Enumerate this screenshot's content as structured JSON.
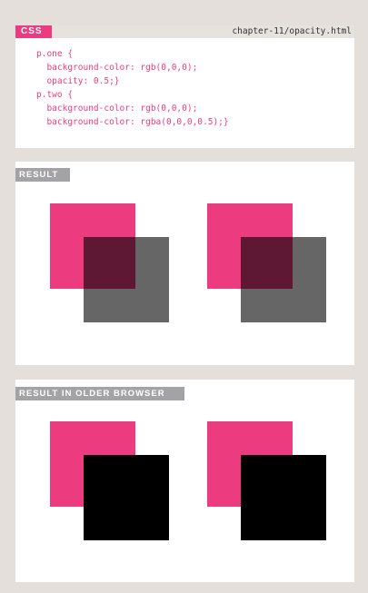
{
  "code_section": {
    "badge": "CSS",
    "file_path": "chapter-11/opacity.html",
    "code_lines": [
      "p.one {",
      "  background-color: rgb(0,0,0);",
      "  opacity: 0.5;}",
      "p.two {",
      "  background-color: rgb(0,0,0);",
      "  background-color: rgba(0,0,0,0.5);}"
    ]
  },
  "result_section": {
    "label": "RESULT"
  },
  "older_browser_section": {
    "label": "RESULT IN OLDER BROWSER"
  },
  "colors": {
    "accent_pink": "#ec3c7f",
    "label_grey": "#a3a3a6",
    "page_background": "#e4dfdb",
    "panel_background": "#ffffff",
    "overlay_black": "#000000"
  }
}
